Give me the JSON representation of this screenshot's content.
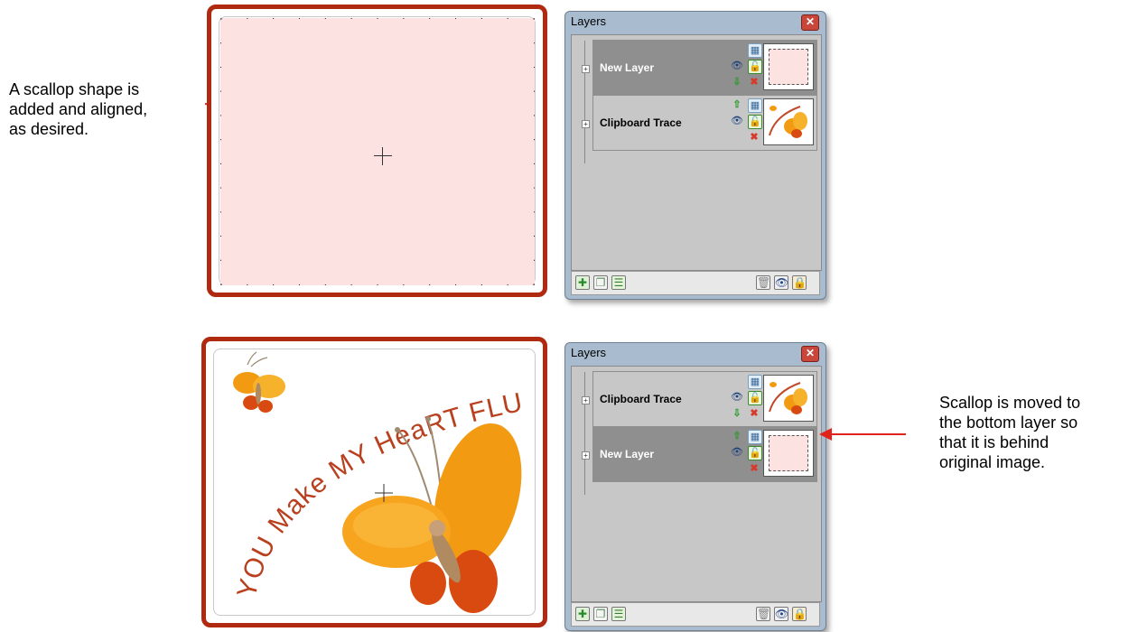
{
  "note_top": {
    "lines": [
      "A scallop shape is",
      "added and aligned,",
      "as desired."
    ]
  },
  "note_bottom": {
    "lines": [
      "Scallop is moved to",
      "the bottom layer so",
      "that it is behind",
      "original image."
    ]
  },
  "artwork_text": "YOU Make MY HeaRT FLUTTer...",
  "panel_top": {
    "title": "Layers",
    "layers": [
      {
        "name": "New Layer",
        "selected": true
      },
      {
        "name": "Clipboard Trace",
        "selected": false
      }
    ]
  },
  "panel_bottom": {
    "title": "Layers",
    "layers": [
      {
        "name": "Clipboard Trace",
        "selected": false
      },
      {
        "name": "New Layer",
        "selected": true
      }
    ]
  },
  "colors": {
    "frame": "#b02a12",
    "scallop_fill": "#fde2e2",
    "butterfly_orange": "#f39a13",
    "butterfly_red": "#d94a10",
    "arrow": "#e0241b"
  }
}
